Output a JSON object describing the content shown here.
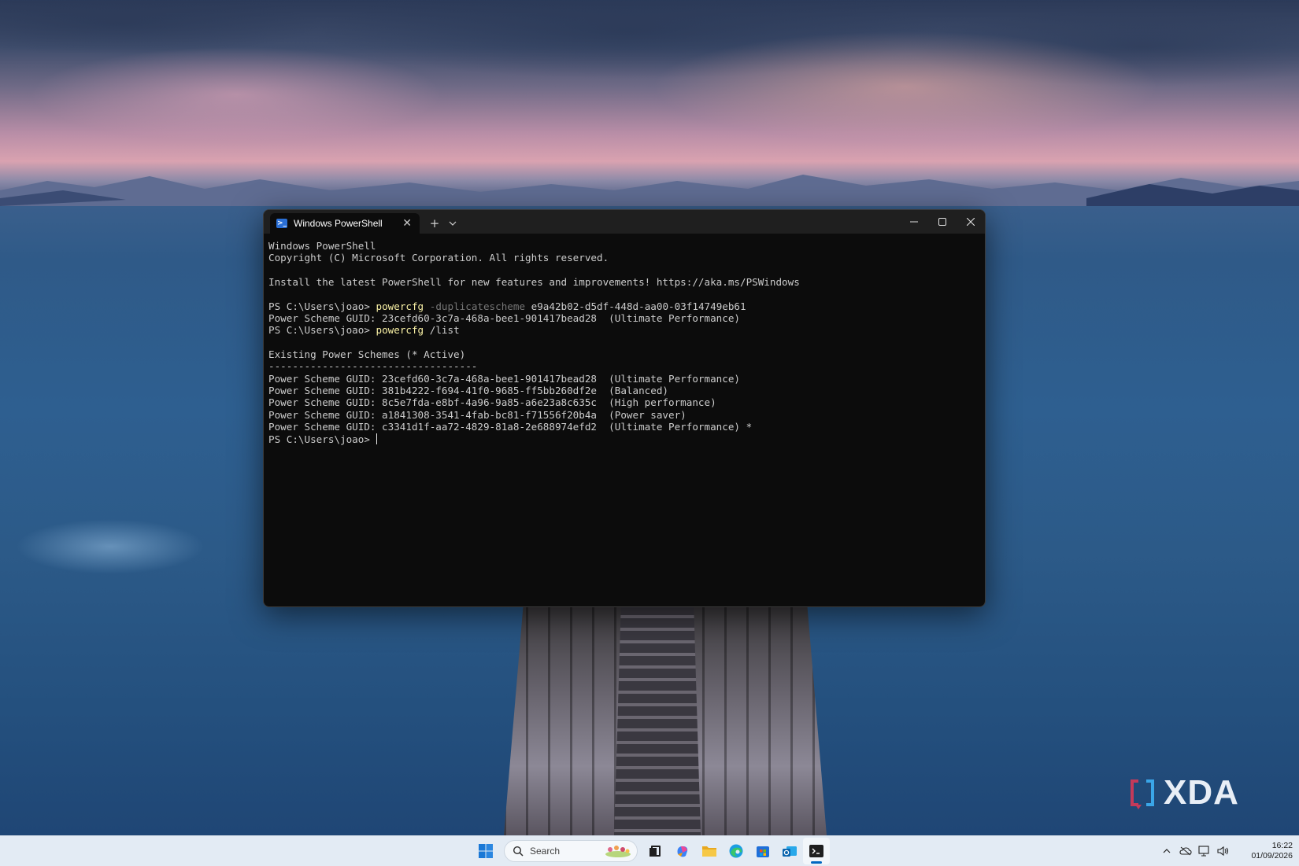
{
  "terminal": {
    "tab_title": "Windows PowerShell",
    "tab_close": "✕",
    "new_tab": "+",
    "dropdown": "⌄",
    "lines": [
      {
        "segments": [
          {
            "t": "Windows PowerShell",
            "c": "out"
          }
        ]
      },
      {
        "segments": [
          {
            "t": "Copyright (C) Microsoft Corporation. All rights reserved.",
            "c": "out"
          }
        ]
      },
      {
        "segments": [
          {
            "t": "",
            "c": "out"
          }
        ]
      },
      {
        "segments": [
          {
            "t": "Install the latest PowerShell for new features and improvements! https://aka.ms/PSWindows",
            "c": "out"
          }
        ]
      },
      {
        "segments": [
          {
            "t": "",
            "c": "out"
          }
        ]
      },
      {
        "segments": [
          {
            "t": "PS C:\\Users\\joao> ",
            "c": "out"
          },
          {
            "t": "powercfg",
            "c": "cmd"
          },
          {
            "t": " -duplicatescheme",
            "c": "param"
          },
          {
            "t": " e9a42b02-d5df-448d-aa00-03f14749eb61",
            "c": "out"
          }
        ]
      },
      {
        "segments": [
          {
            "t": "Power Scheme GUID: 23cefd60-3c7a-468a-bee1-901417bead28  (Ultimate Performance)",
            "c": "out"
          }
        ]
      },
      {
        "segments": [
          {
            "t": "PS C:\\Users\\joao> ",
            "c": "out"
          },
          {
            "t": "powercfg",
            "c": "cmd"
          },
          {
            "t": " /list",
            "c": "out"
          }
        ]
      },
      {
        "segments": [
          {
            "t": "",
            "c": "out"
          }
        ]
      },
      {
        "segments": [
          {
            "t": "Existing Power Schemes (* Active)",
            "c": "out"
          }
        ]
      },
      {
        "segments": [
          {
            "t": "-----------------------------------",
            "c": "out"
          }
        ]
      },
      {
        "segments": [
          {
            "t": "Power Scheme GUID: 23cefd60-3c7a-468a-bee1-901417bead28  (Ultimate Performance)",
            "c": "out"
          }
        ]
      },
      {
        "segments": [
          {
            "t": "Power Scheme GUID: 381b4222-f694-41f0-9685-ff5bb260df2e  (Balanced)",
            "c": "out"
          }
        ]
      },
      {
        "segments": [
          {
            "t": "Power Scheme GUID: 8c5e7fda-e8bf-4a96-9a85-a6e23a8c635c  (High performance)",
            "c": "out"
          }
        ]
      },
      {
        "segments": [
          {
            "t": "Power Scheme GUID: a1841308-3541-4fab-bc81-f71556f20b4a  (Power saver)",
            "c": "out"
          }
        ]
      },
      {
        "segments": [
          {
            "t": "Power Scheme GUID: c3341d1f-aa72-4829-81a8-2e688974efd2  (Ultimate Performance) *",
            "c": "out"
          }
        ]
      },
      {
        "segments": [
          {
            "t": "PS C:\\Users\\joao> ",
            "c": "out"
          }
        ],
        "cursor": true
      }
    ]
  },
  "colors": {
    "console_bg": "#0c0c0c",
    "console_text": "#cccccc",
    "command_yellow": "#f9f1a5",
    "parameter_gray": "#767676",
    "taskbar_bg": "#e3ebf4"
  },
  "taskbar": {
    "search_placeholder": "Search",
    "apps": [
      "start-icon",
      "search",
      "task-view-icon",
      "copilot-icon",
      "file-explorer-icon",
      "edge-icon",
      "microsoft-store-icon",
      "outlook-icon",
      "terminal-icon"
    ],
    "tray": {
      "overflow": "^",
      "date": "01/09/2026",
      "time": "16:22"
    }
  },
  "watermark": {
    "text": "XDA"
  }
}
